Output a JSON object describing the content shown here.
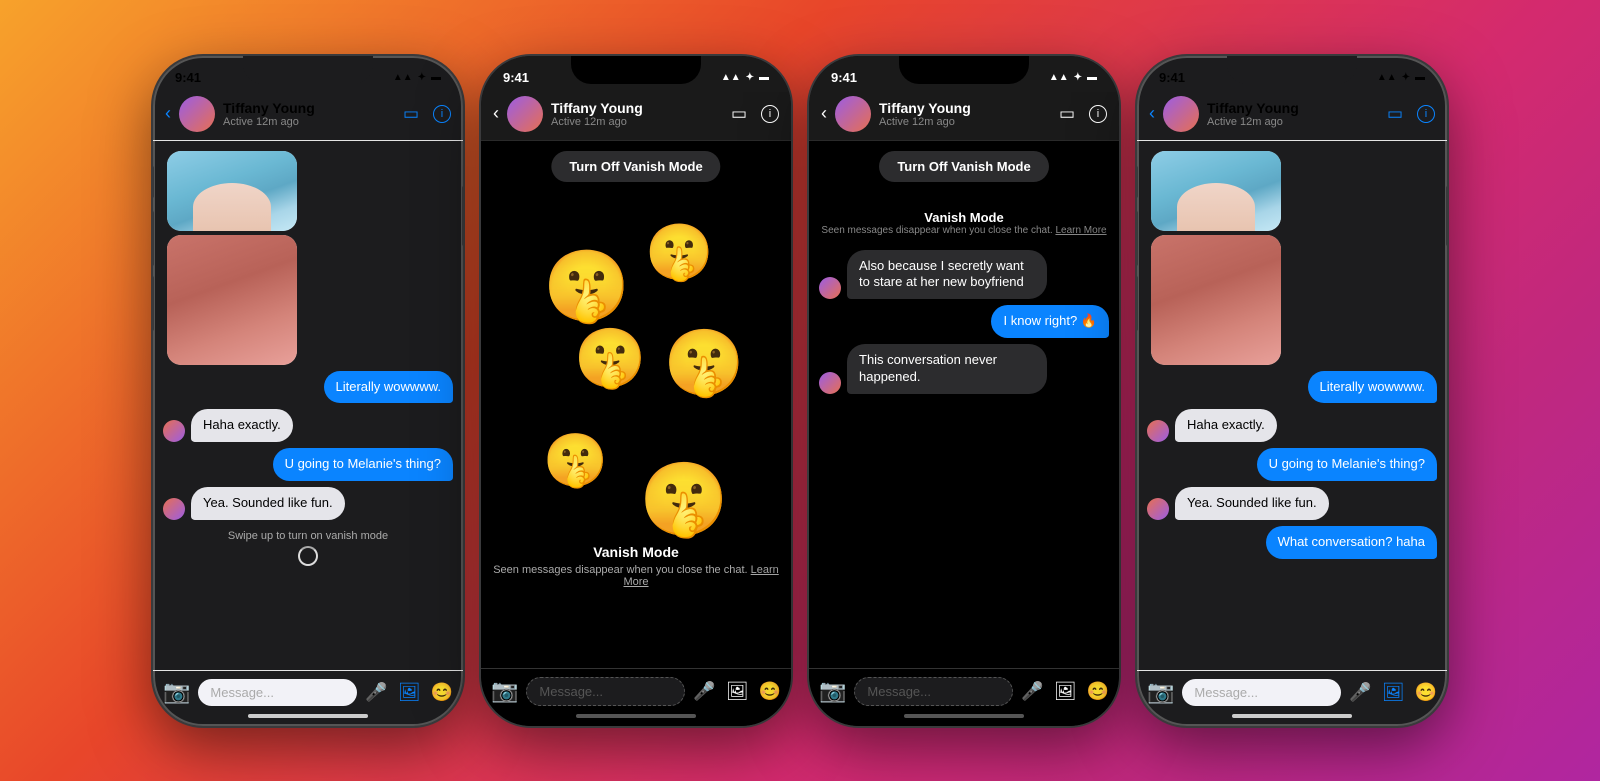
{
  "phones": [
    {
      "id": "phone1",
      "theme": "light",
      "statusBar": {
        "time": "9:41",
        "icons": "▲▲ ✦ ▬"
      },
      "header": {
        "contactName": "Tiffany Young",
        "status": "Active 12m ago"
      },
      "messages": [
        {
          "type": "image-group",
          "side": "left"
        },
        {
          "type": "bubble",
          "side": "right",
          "text": "Literally wowwww.",
          "style": "sent"
        },
        {
          "type": "bubble",
          "side": "left",
          "text": "Haha exactly.",
          "style": "received",
          "hasAvatar": true
        },
        {
          "type": "bubble",
          "side": "right",
          "text": "U going to Melanie's thing?",
          "style": "sent"
        },
        {
          "type": "bubble",
          "side": "left",
          "text": "Yea. Sounded like fun.",
          "style": "received",
          "hasAvatar": true
        }
      ],
      "swipeHint": "Swipe up to turn on vanish mode",
      "inputPlaceholder": "Message..."
    },
    {
      "id": "phone2",
      "theme": "dark-vanish",
      "statusBar": {
        "time": "9:41",
        "icons": "▲▲ ✦ ▬"
      },
      "header": {
        "contactName": "Tiffany Young",
        "status": "Active 12m ago"
      },
      "vanishButton": "Turn Off Vanish Mode",
      "emojis": [
        "🤫",
        "🤫",
        "🤫",
        "🤫",
        "🤫",
        "🤫"
      ],
      "vanishInfo": {
        "title": "Vanish Mode",
        "subtitle": "Seen messages disappear when you close the chat.",
        "learnMore": "Learn More"
      },
      "inputPlaceholder": "Message..."
    },
    {
      "id": "phone3",
      "theme": "dark",
      "statusBar": {
        "time": "9:41",
        "icons": "▲▲ ✦ ▬"
      },
      "header": {
        "contactName": "Tiffany Young",
        "status": "Active 12m ago"
      },
      "vanishButton": "Turn Off Vanish Mode",
      "vanishInfo": {
        "title": "Vanish Mode",
        "subtitle": "Seen messages disappear when you close the chat.",
        "learnMore": "Learn More"
      },
      "messages": [
        {
          "type": "bubble",
          "side": "left",
          "text": "Also because I secretly want to stare at her new boyfriend",
          "style": "received-dark",
          "hasAvatar": true
        },
        {
          "type": "bubble",
          "side": "right",
          "text": "I know right? 🔥",
          "style": "sent"
        },
        {
          "type": "bubble",
          "side": "left",
          "text": "This conversation never happened.",
          "style": "received-dark",
          "hasAvatar": true
        }
      ],
      "inputPlaceholder": "Message..."
    },
    {
      "id": "phone4",
      "theme": "light",
      "statusBar": {
        "time": "9:41",
        "icons": "▲▲ ✦ ▬"
      },
      "header": {
        "contactName": "Tiffany Young",
        "status": "Active 12m ago"
      },
      "messages": [
        {
          "type": "image-group",
          "side": "left"
        },
        {
          "type": "bubble",
          "side": "right",
          "text": "Literally wowwww.",
          "style": "sent"
        },
        {
          "type": "bubble",
          "side": "left",
          "text": "Haha exactly.",
          "style": "received",
          "hasAvatar": true
        },
        {
          "type": "bubble",
          "side": "right",
          "text": "U going to Melanie's thing?",
          "style": "sent"
        },
        {
          "type": "bubble",
          "side": "left",
          "text": "Yea. Sounded like fun.",
          "style": "received",
          "hasAvatar": true
        },
        {
          "type": "bubble",
          "side": "right",
          "text": "What conversation? haha",
          "style": "sent"
        }
      ],
      "inputPlaceholder": "Message..."
    }
  ],
  "labels": {
    "backArrow": "‹",
    "videoIcon": "⬜",
    "infoIcon": "ⓘ",
    "cameraIcon": "📷",
    "micIcon": "🎤",
    "photoIcon": "🖼",
    "stickerIcon": "😊",
    "activeStatus": "Active 12m ago",
    "swipeHint": "Swipe up to turn on vanish mode",
    "vanishModeTitle": "Vanish Mode",
    "vanishModeSub": "Seen messages disappear when you close the chat.",
    "learnMore": "Learn More",
    "turnOffVanish": "Turn Off Vanish Mode"
  }
}
